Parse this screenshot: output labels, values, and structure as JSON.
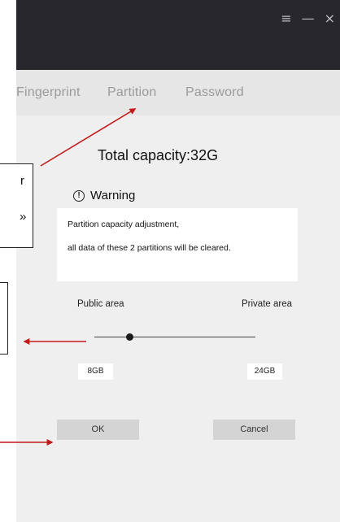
{
  "window": {
    "controls": [
      {
        "name": "menu-icon",
        "glyph": "≡"
      },
      {
        "name": "minimize-icon",
        "glyph": "—"
      },
      {
        "name": "close-icon",
        "glyph": "×"
      }
    ]
  },
  "tabs": [
    {
      "label": "Fingerprint"
    },
    {
      "label": "Partition"
    },
    {
      "label": "Password"
    }
  ],
  "main": {
    "capacity": "Total capacity:32G",
    "warning_title": "Warning",
    "warning_lines": [
      "Partition capacity adjustment,",
      "all data of these 2 partitions will be cleared."
    ],
    "public_label": "Public area",
    "private_label": "Private area",
    "slider_value_fraction": 0.2,
    "public_size": "8GB",
    "private_size": "24GB",
    "ok_label": "OK",
    "cancel_label": "Cancel"
  },
  "annotations": {
    "callout_top_fragments": [
      "r",
      "»"
    ],
    "arrow_color": "#c21a1a"
  },
  "colors": {
    "titlebar": "#27272c",
    "tabbar": "#e6e6e6",
    "panel": "#efefef",
    "button": "#d4d4d4"
  }
}
